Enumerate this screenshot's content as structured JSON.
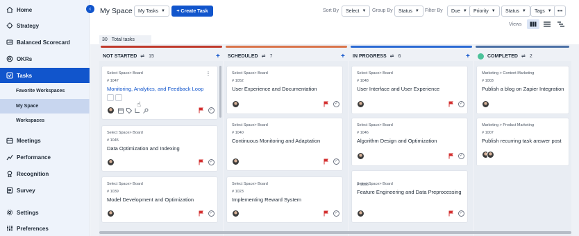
{
  "sidebar": {
    "items": [
      {
        "label": "Home",
        "icon": "home-icon"
      },
      {
        "label": "Strategy",
        "icon": "strategy-icon"
      },
      {
        "label": "Balanced Scorecard",
        "icon": "scorecard-icon"
      },
      {
        "label": "OKRs",
        "icon": "okr-icon"
      },
      {
        "label": "Tasks",
        "icon": "tasks-icon"
      },
      {
        "label": "Meetings",
        "icon": "meetings-icon"
      },
      {
        "label": "Performance",
        "icon": "performance-icon"
      },
      {
        "label": "Recognition",
        "icon": "recognition-icon"
      },
      {
        "label": "Survey",
        "icon": "survey-icon"
      },
      {
        "label": "Settings",
        "icon": "settings-icon"
      },
      {
        "label": "Preferences",
        "icon": "preferences-icon"
      }
    ],
    "sub_items": [
      {
        "label": "Favorite Workspaces"
      },
      {
        "label": "My Space"
      },
      {
        "label": "Workspaces"
      }
    ],
    "collapse_icon": "‹"
  },
  "header": {
    "title": "My Space",
    "view_select": "My Tasks",
    "create_label": "+ Create Task",
    "sort_by_label": "Sort By",
    "sort_select": "Select",
    "group_by_label": "Group By",
    "group_select": "Status",
    "filter_by_label": "Filter By",
    "filters": [
      "Due",
      "Priority",
      "Status",
      "Tags"
    ],
    "more_label": "•••",
    "views_label": "Views"
  },
  "summary": {
    "total_count": "30",
    "total_label": "Total tasks"
  },
  "columns": [
    {
      "name": "NOT STARTED",
      "count": "15",
      "color": "#c0392b",
      "cards": [
        {
          "path": "Select Space> Board",
          "id": "# 1047",
          "title": "Monitoring, Analytics, and Feedback Loop"
        },
        {
          "path": "Select Space> Board",
          "id": "# 1045",
          "title": "Data Optimization and Indexing"
        },
        {
          "path": "Select Space> Board",
          "id": "# 1039",
          "title": "Model Development and Optimization"
        }
      ]
    },
    {
      "name": "SCHEDULED",
      "count": "7",
      "color": "#d9744a",
      "cards": [
        {
          "path": "Select Space> Board",
          "id": "# 1052",
          "title": "User Experience and Documentation"
        },
        {
          "path": "Select Space> Board",
          "id": "# 1040",
          "title": "Continuous Monitoring and Adaptation"
        },
        {
          "path": "Select Space> Board",
          "id": "# 1023",
          "title": "Implementing Reward System"
        }
      ]
    },
    {
      "name": "IN PROGRESS",
      "count": "6",
      "color": "#2a6ad3",
      "cards": [
        {
          "path": "Select Space> Board",
          "id": "# 1048",
          "title": "User Interface and User Experience"
        },
        {
          "path": "Select Space> Board",
          "id": "# 1046",
          "title": "Algorithm Design and Optimization"
        },
        {
          "path": "Select Space> Board",
          "id": "# 1038",
          "title": "Feature Engineering and Data Preprocessing"
        }
      ]
    },
    {
      "name": "COMPLETED",
      "count": "2",
      "color": "#4a6fa5",
      "cards": [
        {
          "path": "Marketing > Content Marketing",
          "id": "# 1003",
          "title": "Publish a blog on Zapier Integration"
        },
        {
          "path": "Marketing > Product Marketing",
          "id": "# 1007",
          "title": "Publish recurring task answer post"
        }
      ]
    }
  ],
  "colors": {
    "accent": "#1155cc",
    "flag": "#d32f2f",
    "completed_dot": "#4cc29a"
  }
}
